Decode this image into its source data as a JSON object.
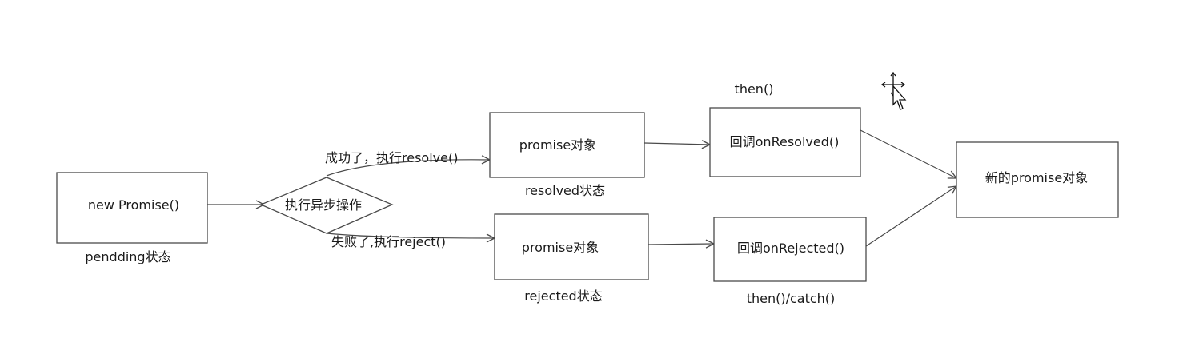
{
  "nodes": {
    "new_promise": "new Promise()",
    "async_op": "执行异步操作",
    "promise_resolved": "promise对象",
    "promise_rejected": "promise对象",
    "on_resolved": "回调onResolved()",
    "on_rejected": "回调onRejected()",
    "new_promise_object": "新的promise对象"
  },
  "labels": {
    "pending_state": "pendding状态",
    "success_edge": "成功了，执行resolve()",
    "fail_edge": "失败了,执行reject()",
    "resolved_state": "resolved状态",
    "rejected_state": "rejected状态",
    "then": "then()",
    "then_catch": "then()/catch()"
  },
  "cursor": {
    "icon": "arrow-move-cursor-icon"
  }
}
